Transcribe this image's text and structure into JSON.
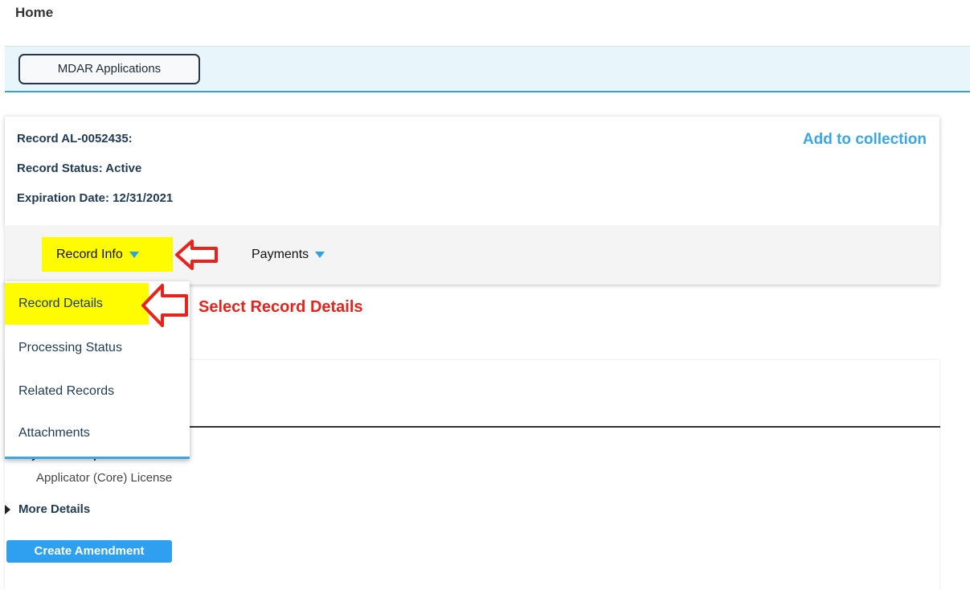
{
  "page": {
    "title": "Home"
  },
  "app_bar": {
    "button_label": "MDAR Applications"
  },
  "record": {
    "id_line": "Record AL-0052435:",
    "status_line": "Record Status: Active",
    "expiration_line": "Expiration Date: 12/31/2021",
    "add_to_collection": "Add to collection"
  },
  "tabs": [
    {
      "label": "Record Info",
      "highlighted": true
    },
    {
      "label": "Payments",
      "highlighted": false
    }
  ],
  "dropdown": {
    "items": [
      {
        "label": "Record Details",
        "selected": true
      },
      {
        "label": "Processing Status",
        "selected": false
      },
      {
        "label": "Related Records",
        "selected": false
      },
      {
        "label": "Attachments",
        "selected": false
      }
    ]
  },
  "annotation": {
    "text": "Select Record Details",
    "color": "#e8231c"
  },
  "details": {
    "project_description_label": "Project Description:",
    "project_description_value": "Applicator (Core) License",
    "more_details": "More Details",
    "create_amendment": "Create Amendment"
  },
  "colors": {
    "accent": "#3aa6e6",
    "highlight": "#fffb00",
    "button_blue": "#2ea0ef"
  }
}
